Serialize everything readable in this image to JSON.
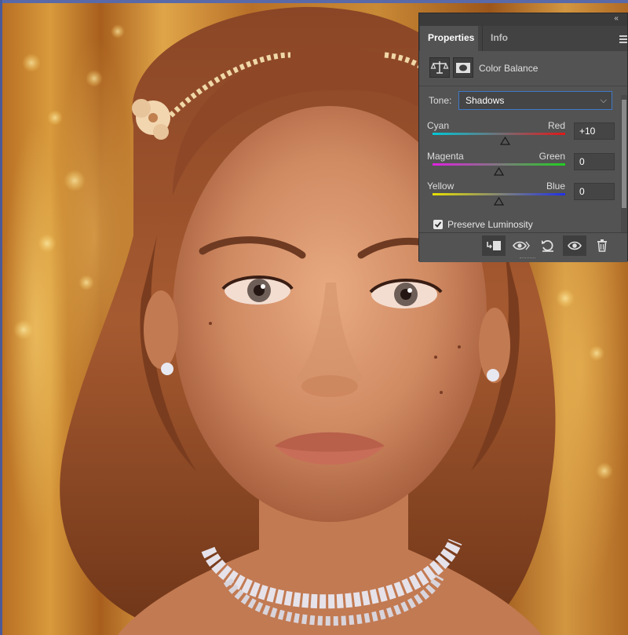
{
  "panel": {
    "collapse_glyph": "‹‹",
    "close_glyph": "✕",
    "tabs": [
      {
        "label": "Properties",
        "active": true
      },
      {
        "label": "Info",
        "active": false
      }
    ],
    "menu_icon": "hamburger-menu-icon",
    "header_title": "Color Balance",
    "header_icons": [
      "color-balance-scale-icon",
      "layer-mask-icon"
    ],
    "tone": {
      "label": "Tone:",
      "value": "Shadows",
      "caret": "⌵"
    },
    "sliders": [
      {
        "left": "Cyan",
        "right": "Red",
        "value": "+10",
        "level": 10,
        "track_from": "#00c8d8",
        "track_to": "#e01818"
      },
      {
        "left": "Magenta",
        "right": "Green",
        "value": "0",
        "level": 0,
        "track_from": "#e020e0",
        "track_to": "#20d020"
      },
      {
        "left": "Yellow",
        "right": "Blue",
        "value": "0",
        "level": 0,
        "track_from": "#e8e000",
        "track_to": "#2030e8"
      }
    ],
    "preserve_luminosity": {
      "label": "Preserve Luminosity",
      "checked": true
    },
    "footer_icons": [
      "clip-to-layer-icon",
      "view-previous-state-icon",
      "reset-icon",
      "toggle-visibility-icon",
      "delete-icon"
    ]
  },
  "colors": {
    "panel_bg": "#535353",
    "tab_bar": "#424242",
    "focus_border": "#3f79c8"
  }
}
